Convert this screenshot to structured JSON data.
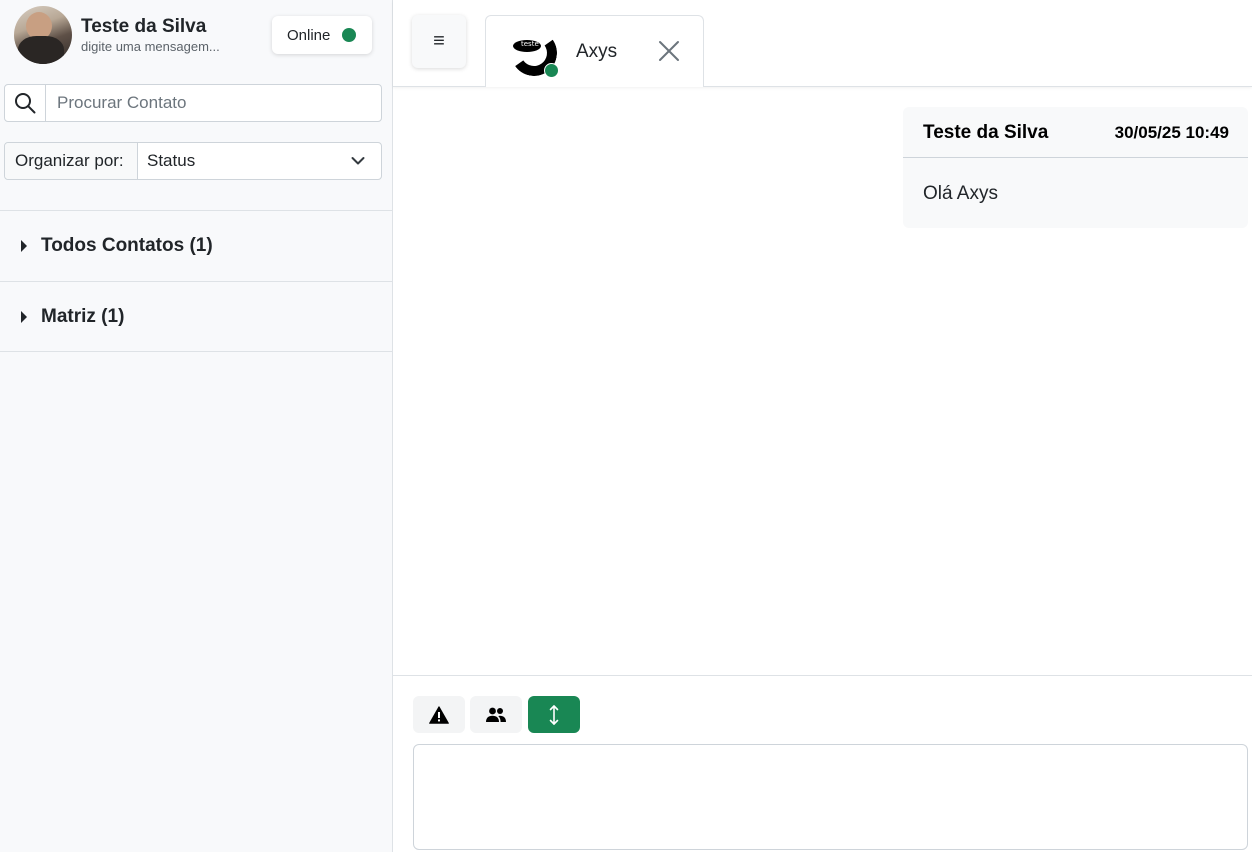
{
  "profile": {
    "name": "Teste da Silva",
    "status_message": "digite uma mensagem...",
    "presence_label": "Online",
    "presence_color": "#198754"
  },
  "search": {
    "placeholder": "Procurar Contato",
    "value": "",
    "icon": "search-icon"
  },
  "sort": {
    "label": "Organizar por:",
    "selected": "Status",
    "icon": "chevron-down-icon"
  },
  "groups": [
    {
      "label": "Todos Contatos (1)",
      "icon": "caret-right-icon"
    },
    {
      "label": "Matriz (1)",
      "icon": "caret-right-icon"
    }
  ],
  "topbar": {
    "menu_icon": "≡",
    "tab": {
      "title": "Axys",
      "logo_text": "teste",
      "close_icon": "close-icon"
    }
  },
  "conversation": {
    "messages": [
      {
        "sender": "Teste da Silva",
        "timestamp": "30/05/25 10:49",
        "text": "Olá Axys"
      }
    ]
  },
  "composer": {
    "tools": [
      {
        "icon": "warning-icon"
      },
      {
        "icon": "users-icon"
      },
      {
        "icon": "resize-vertical-icon",
        "active": true
      }
    ],
    "value": "",
    "accent_color": "#198754"
  }
}
